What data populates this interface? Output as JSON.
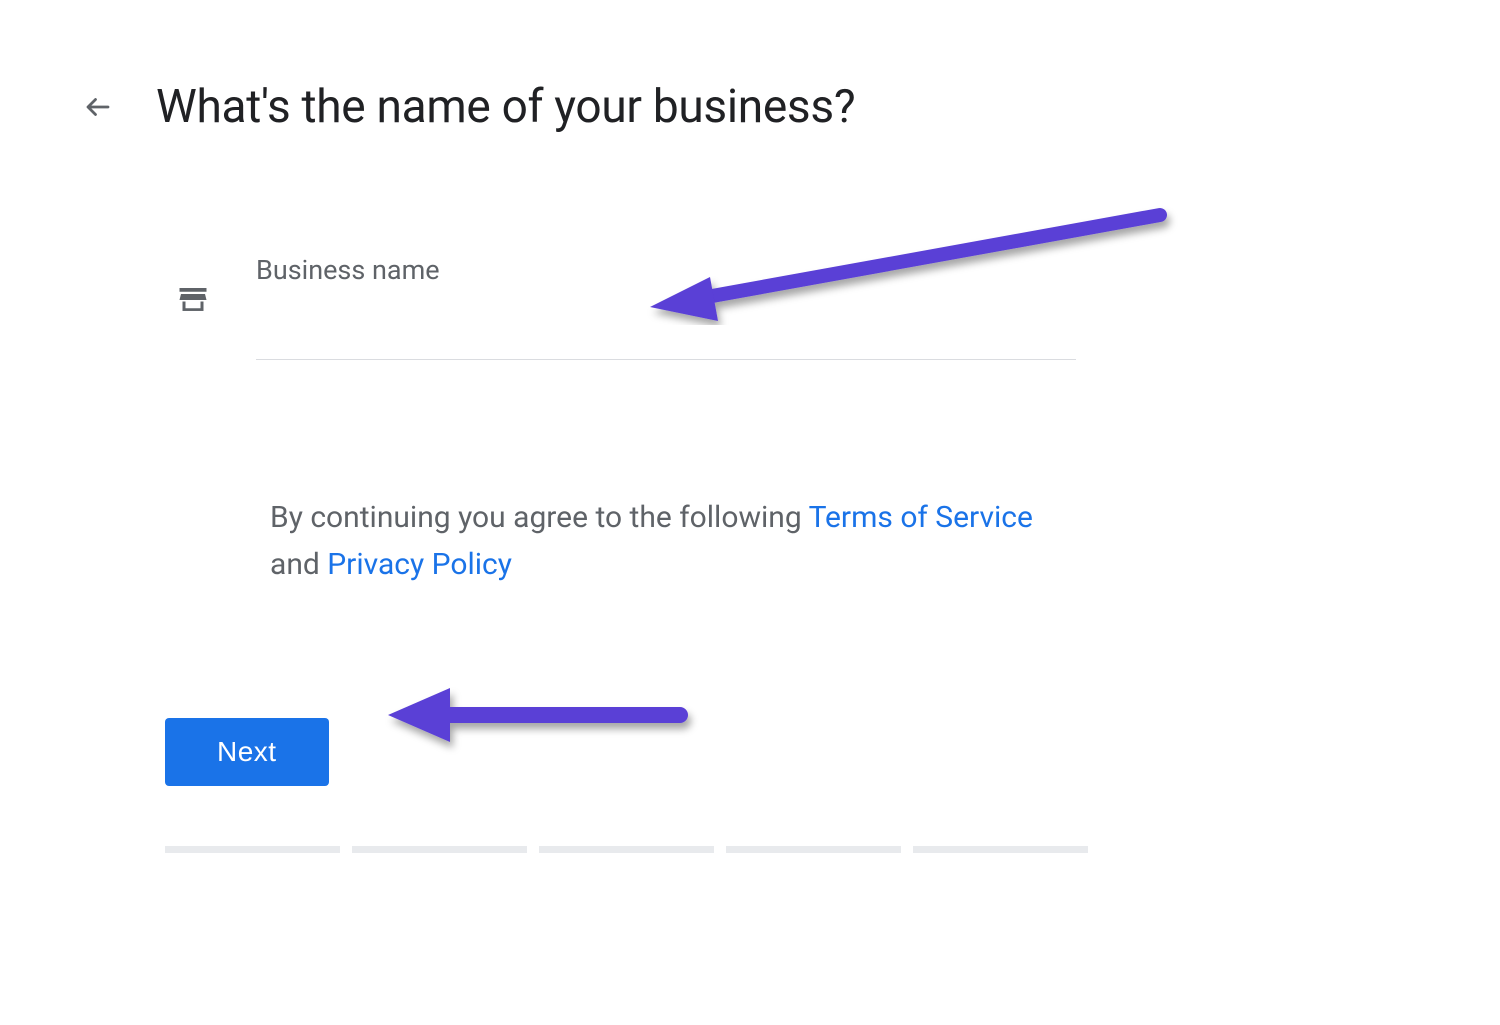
{
  "header": {
    "title": "What's the name of your business?"
  },
  "form": {
    "business_name_label": "Business name",
    "business_name_value": ""
  },
  "legal": {
    "prefix": "By continuing you agree to the following ",
    "terms_link": "Terms of Service",
    "and": " and ",
    "privacy_link": "Privacy Policy"
  },
  "actions": {
    "next_label": "Next"
  },
  "progress": {
    "segments": 5
  },
  "annotations": {
    "arrow_color": "#5a3fd6"
  }
}
